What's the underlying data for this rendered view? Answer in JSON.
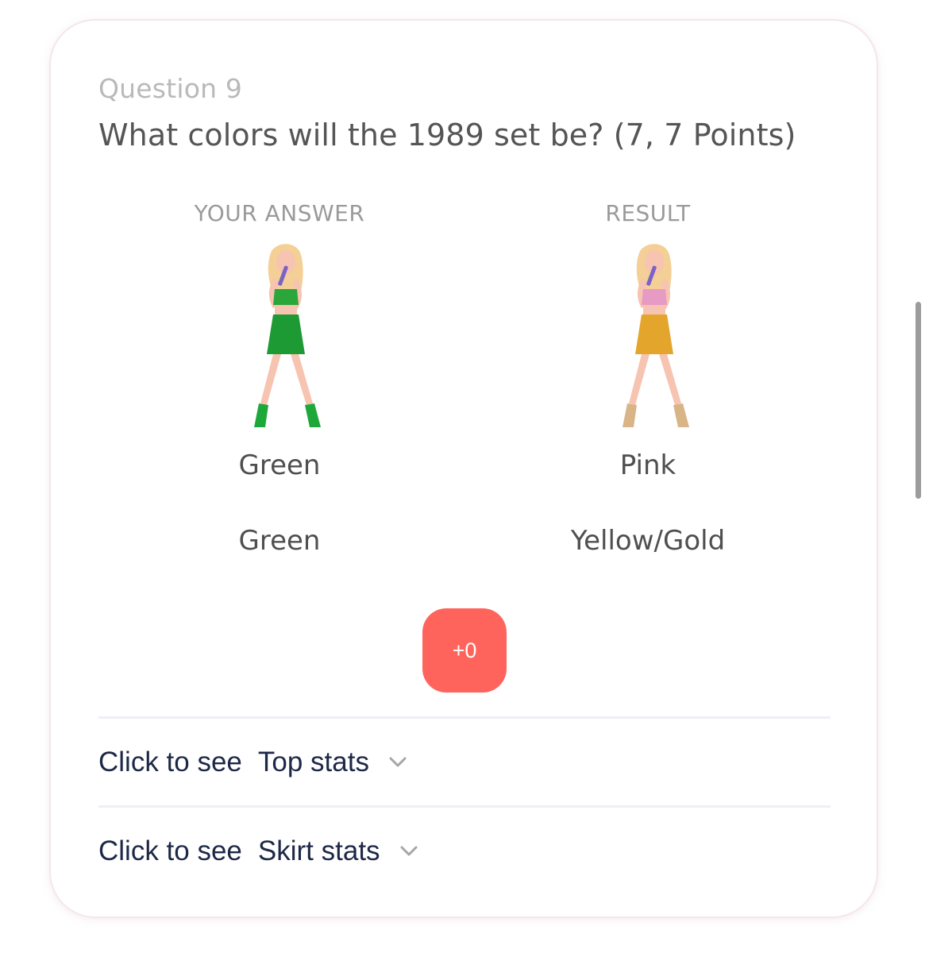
{
  "question": {
    "number_label": "Question 9",
    "text": "What colors will the 1989 set be? (7, 7 Points)"
  },
  "columns": {
    "your_answer": {
      "header": "YOUR ANSWER",
      "top": "Green",
      "skirt": "Green",
      "colors": {
        "top": "#2aa63a",
        "skirt": "#1e9a34",
        "boots": "#1fa83a"
      }
    },
    "result": {
      "header": "RESULT",
      "top": "Pink",
      "skirt": "Yellow/Gold",
      "colors": {
        "top": "#e79ac4",
        "skirt": "#e4a52c",
        "boots": "#d8b487"
      }
    }
  },
  "score": {
    "label": "+0",
    "color": "#ff645c"
  },
  "stats": [
    {
      "prefix": "Click to see",
      "label": "Top stats",
      "icon": "chevron-down-icon"
    },
    {
      "prefix": "Click to see",
      "label": "Skirt stats",
      "icon": "chevron-down-icon"
    }
  ]
}
